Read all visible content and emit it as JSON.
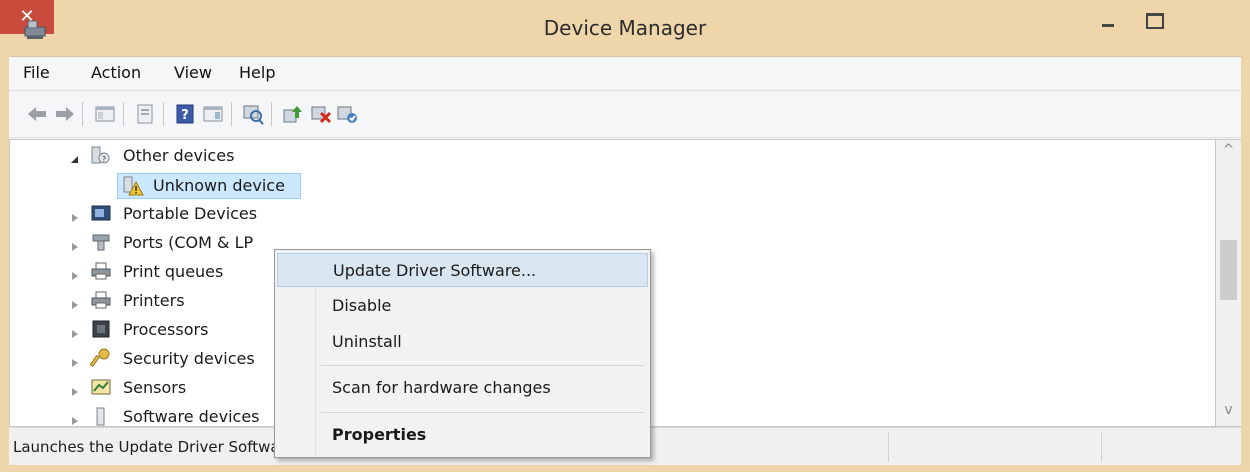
{
  "window": {
    "title": "Device Manager",
    "close_glyph": "✕",
    "accent_color": "#efd5aa",
    "close_color": "#c84b3c"
  },
  "menubar": {
    "items": [
      {
        "label": "File"
      },
      {
        "label": "Action"
      },
      {
        "label": "View"
      },
      {
        "label": "Help"
      }
    ]
  },
  "toolbar": {
    "buttons": [
      {
        "icon": "back-arrow-icon"
      },
      {
        "icon": "forward-arrow-icon"
      },
      {
        "icon": "show-hide-console-tree-icon"
      },
      {
        "icon": "properties-icon"
      },
      {
        "icon": "help-icon"
      },
      {
        "icon": "show-action-pane-icon"
      },
      {
        "icon": "scan-hardware-icon"
      },
      {
        "icon": "update-driver-icon"
      },
      {
        "icon": "uninstall-device-icon"
      },
      {
        "icon": "enable-device-icon"
      }
    ]
  },
  "tree": {
    "nodes": [
      {
        "label": "Other devices",
        "icon": "unknown-devices-folder-icon",
        "state": "expanded"
      },
      {
        "label": "Unknown device",
        "icon": "warning-device-icon",
        "state": "leaf",
        "selected": true
      },
      {
        "label": "Portable Devices",
        "icon": "portable-device-icon",
        "state": "collapsed"
      },
      {
        "label": "Ports (COM & LP",
        "icon": "port-icon",
        "state": "collapsed"
      },
      {
        "label": "Print queues",
        "icon": "printer-icon",
        "state": "collapsed"
      },
      {
        "label": "Printers",
        "icon": "printer-icon",
        "state": "collapsed"
      },
      {
        "label": "Processors",
        "icon": "processor-icon",
        "state": "collapsed"
      },
      {
        "label": "Security devices",
        "icon": "key-icon",
        "state": "collapsed"
      },
      {
        "label": "Sensors",
        "icon": "sensor-icon",
        "state": "collapsed"
      },
      {
        "label": "Software devices",
        "icon": "software-device-icon",
        "state": "collapsed"
      }
    ]
  },
  "context_menu": {
    "items": [
      {
        "label": "Update Driver Software...",
        "highlighted": true
      },
      {
        "label": "Disable"
      },
      {
        "label": "Uninstall"
      },
      {
        "label": "Scan for hardware changes"
      },
      {
        "label": "Properties",
        "bold": true
      }
    ]
  },
  "scrollbar": {
    "up_glyph": "^",
    "down_glyph": "v"
  },
  "statusbar": {
    "text": "Launches the Update Driver Software Wizard for the selected device."
  }
}
